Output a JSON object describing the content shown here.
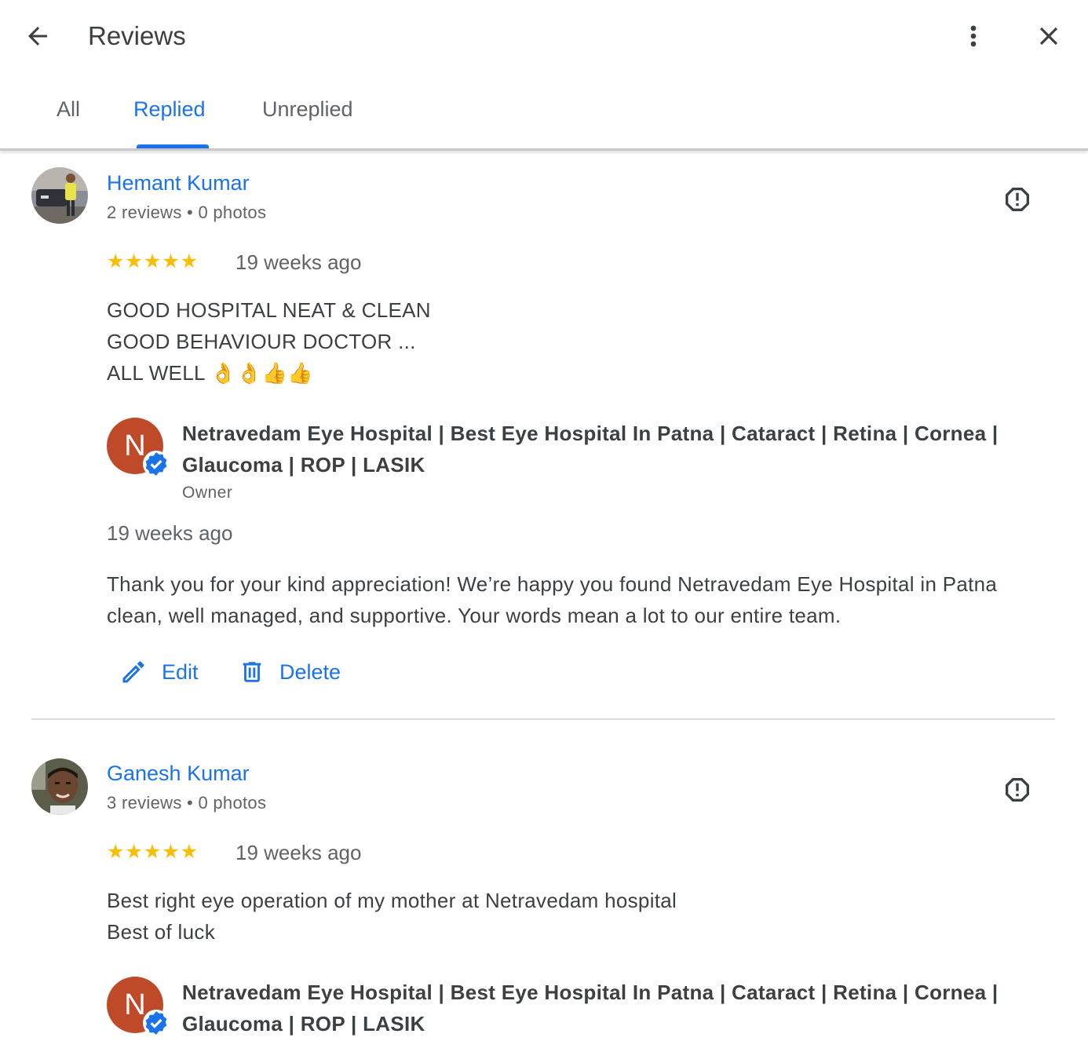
{
  "header": {
    "title": "Reviews",
    "back_icon": "arrow-back-icon",
    "more_icon": "more-vert-icon",
    "close_icon": "close-icon"
  },
  "tabs": [
    {
      "label": "All",
      "active": false
    },
    {
      "label": "Replied",
      "active": true
    },
    {
      "label": "Unreplied",
      "active": false
    }
  ],
  "colors": {
    "accent": "#1a73e8",
    "star": "#fbbc04",
    "owner_avatar": "#bf4a2a",
    "divider": "#dadce0"
  },
  "reviews": [
    {
      "reviewer_name": "Hemant Kumar",
      "reviewer_meta": "2 reviews • 0 photos",
      "rating": 5,
      "stars": "★★★★★",
      "time": "19 weeks ago",
      "text_lines": [
        "GOOD HOSPITAL NEAT & CLEAN",
        "GOOD BEHAVIOUR DOCTOR ...",
        "ALL WELL 👌👌👍👍"
      ],
      "reply": {
        "owner_initial": "N",
        "owner_name": "Netravedam Eye Hospital | Best Eye Hospital In Patna | Cataract | Retina | Cornea | Glaucoma | ROP | LASIK",
        "owner_role": "Owner",
        "time": "19 weeks ago",
        "text": "Thank you for your kind appreciation! We’re happy you found Netravedam Eye Hospital in Patna clean, well managed, and supportive. Your words mean a lot to our entire team."
      },
      "actions": {
        "edit_label": "Edit",
        "delete_label": "Delete"
      }
    },
    {
      "reviewer_name": "Ganesh Kumar",
      "reviewer_meta": "3 reviews • 0 photos",
      "rating": 5,
      "stars": "★★★★★",
      "time": "19 weeks ago",
      "text_lines": [
        "Best right eye operation of my mother at Netravedam hospital",
        "Best of luck"
      ],
      "reply": {
        "owner_initial": "N",
        "owner_name": "Netravedam Eye Hospital | Best Eye Hospital In Patna | Cataract | Retina | Cornea | Glaucoma | ROP | LASIK"
      }
    }
  ]
}
